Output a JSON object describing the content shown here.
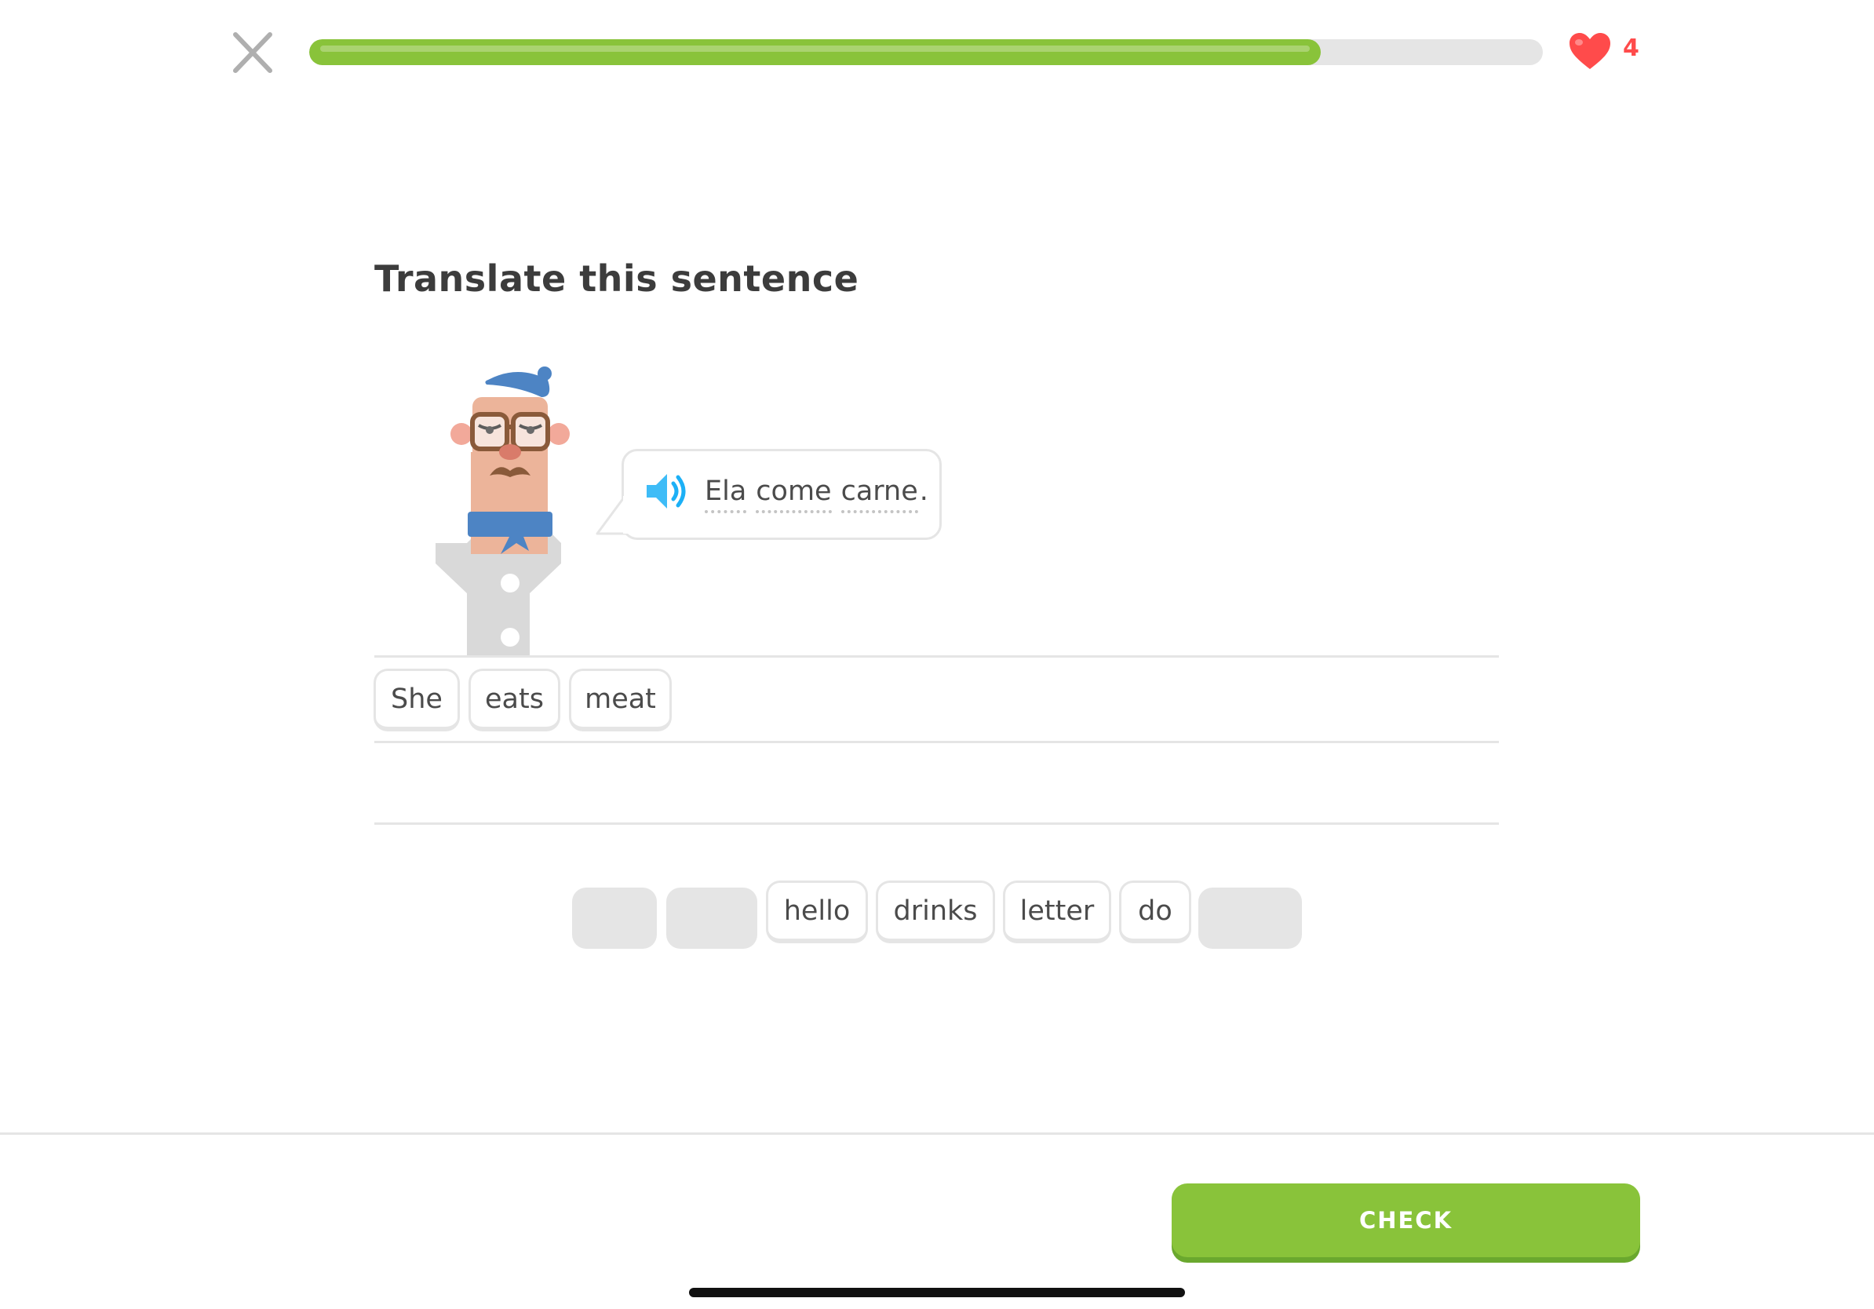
{
  "header": {
    "close_icon": "close-icon",
    "progress_fraction": 0.82,
    "progress_color": "#89c33a",
    "heart_icon": "heart-icon",
    "hearts": "4",
    "heart_color": "#ff4b4b"
  },
  "prompt": {
    "title": "Translate this sentence",
    "speaker_icon": "speaker-icon",
    "sentence_words": [
      "Ela",
      "come",
      "carne"
    ],
    "sentence_end": "."
  },
  "answer": {
    "selected_words": [
      "She",
      "eats",
      "meat"
    ]
  },
  "word_bank": {
    "tiles": [
      {
        "label": "",
        "used": true
      },
      {
        "label": "",
        "used": true
      },
      {
        "label": "hello",
        "used": false
      },
      {
        "label": "drinks",
        "used": false
      },
      {
        "label": "letter",
        "used": false
      },
      {
        "label": "do",
        "used": false
      },
      {
        "label": "",
        "used": true
      }
    ]
  },
  "footer": {
    "check_label": "CHECK",
    "check_color": "#89c33a"
  }
}
